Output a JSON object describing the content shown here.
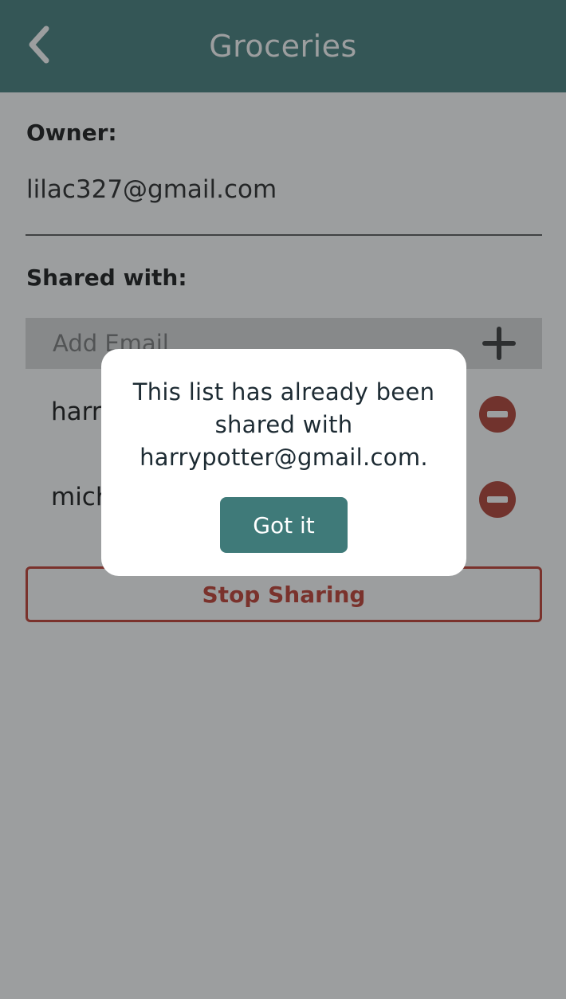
{
  "header": {
    "title": "Groceries",
    "back_icon": "chevron-left-icon"
  },
  "owner": {
    "label": "Owner:",
    "email": "lilac327@gmail.com"
  },
  "shared": {
    "label": "Shared with:",
    "add_placeholder": "Add Email",
    "add_icon": "plus-icon",
    "items": [
      {
        "email": "harr",
        "remove_icon": "remove-circle-icon"
      },
      {
        "email": "mich",
        "remove_icon": "remove-circle-icon"
      }
    ]
  },
  "stop_sharing_label": "Stop Sharing",
  "dialog": {
    "message": "This list has already been shared with harrypotter@gmail.com.",
    "confirm_label": "Got it"
  },
  "colors": {
    "header": "#3f7a79",
    "accent": "#3f7a79",
    "danger": "#c0392b",
    "remove_icon": "#b03a2e"
  }
}
